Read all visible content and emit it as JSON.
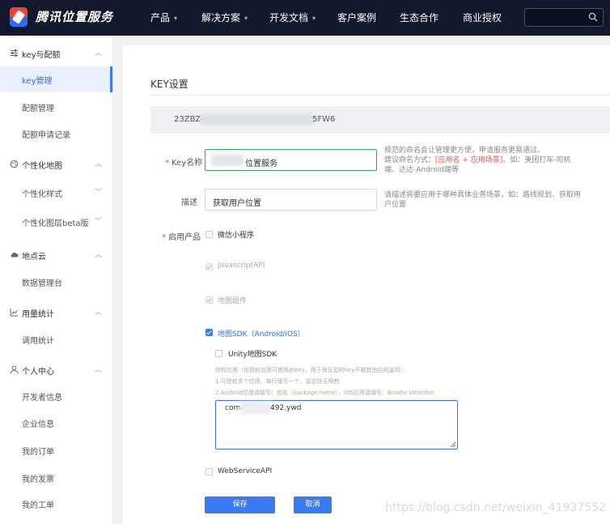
{
  "header": {
    "brand": "腾讯位置服务",
    "nav": [
      {
        "label": "产品",
        "caret": "▾"
      },
      {
        "label": "解决方案",
        "caret": "▾"
      },
      {
        "label": "开发文档",
        "caret": "▾"
      },
      {
        "label": "客户案例",
        "caret": ""
      },
      {
        "label": "生态合作",
        "caret": ""
      },
      {
        "label": "商业授权",
        "caret": ""
      }
    ],
    "search_placeholder": ""
  },
  "sidebar": {
    "groups": [
      {
        "label": "key与配额",
        "icon": "sliders-icon",
        "items": [
          "key管理",
          "配额管理",
          "配额申请记录"
        ]
      },
      {
        "label": "个性化地图",
        "icon": "palette-icon",
        "items": [
          "个性化样式",
          "个性化图层beta版"
        ]
      },
      {
        "label": "地点云",
        "icon": "cloud-icon",
        "items": [
          "数据管理台"
        ]
      },
      {
        "label": "用量统计",
        "icon": "chart-icon",
        "items": [
          "调用统计"
        ]
      },
      {
        "label": "个人中心",
        "icon": "user-icon",
        "items": [
          "开发者信息",
          "企业信息",
          "我的订单",
          "我的发票",
          "我的工单"
        ]
      }
    ],
    "active_item": "key管理"
  },
  "main": {
    "title": "KEY设置",
    "key_prefix": "23ZBZ-",
    "key_suffix": "5FW6",
    "fields": {
      "name_label": "Key名称",
      "name_value": "位置服务",
      "name_hint_1": "规范的命名会让管理更方便，申请服务更易通过。",
      "name_hint_2a": "建议命名方式：",
      "name_hint_2b": "[应用名 + 应用场景]",
      "name_hint_2c": "。如：美团打车-司机端、达达-Android端等",
      "desc_label": "描述",
      "desc_value": "获取用户位置",
      "desc_hint": "请描述将要应用于哪种具体业务场景，如：路线规划、获取用户位置",
      "products_label": "启用产品"
    },
    "products": [
      {
        "label": "微信小程序",
        "state": "unchecked"
      },
      {
        "label": "JavascriptAPI",
        "state": "disabled-checked"
      },
      {
        "label": "地图组件",
        "state": "disabled-checked"
      },
      {
        "label": "地图SDK（Android/iOS）",
        "state": "checked"
      },
      {
        "label": "Unity地图SDK",
        "state": "unchecked"
      },
      {
        "label": "WebServiceAPI",
        "state": "unchecked"
      }
    ],
    "sdk_notes": [
      "授权应用（仅授权应用可使用此Key，用于保证您的Key不被其他应用盗用）：",
      "1.可授权多个应用，每行填写一个，留空则无限制",
      "2.Android应用请填写：包名（package name），iOS应用请填写：Bundle Identifier"
    ],
    "app_id_prefix": "com.",
    "app_id_suffix": "492.ywd",
    "save_label": "保存",
    "cancel_label": "取消"
  },
  "watermark": "https://blog.csdn.net/weixin_41937552"
}
